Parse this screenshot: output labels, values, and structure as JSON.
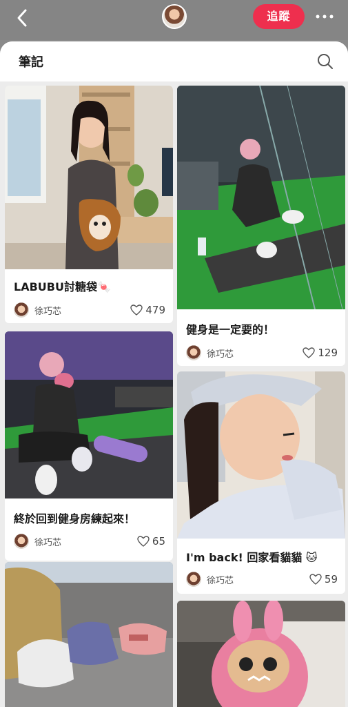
{
  "header": {
    "follow_label": "追蹤",
    "icons": [
      "back-arrow-icon",
      "more-icon"
    ],
    "accent": "#ee2f4e"
  },
  "sheet": {
    "title": "筆記",
    "search_icon": "search-icon"
  },
  "notes": [
    {
      "title": "LABUBU討糖袋🍬",
      "author": "徐巧芯",
      "likes": "479"
    },
    {
      "title": "健身是一定要的！",
      "author": "徐巧芯",
      "likes": "129"
    },
    {
      "title": "終於回到健身房練起來！",
      "author": "徐巧芯",
      "likes": "65"
    },
    {
      "title": "I'm back! 回家看貓貓 🐱",
      "author": "徐巧芯",
      "likes": "59"
    }
  ]
}
